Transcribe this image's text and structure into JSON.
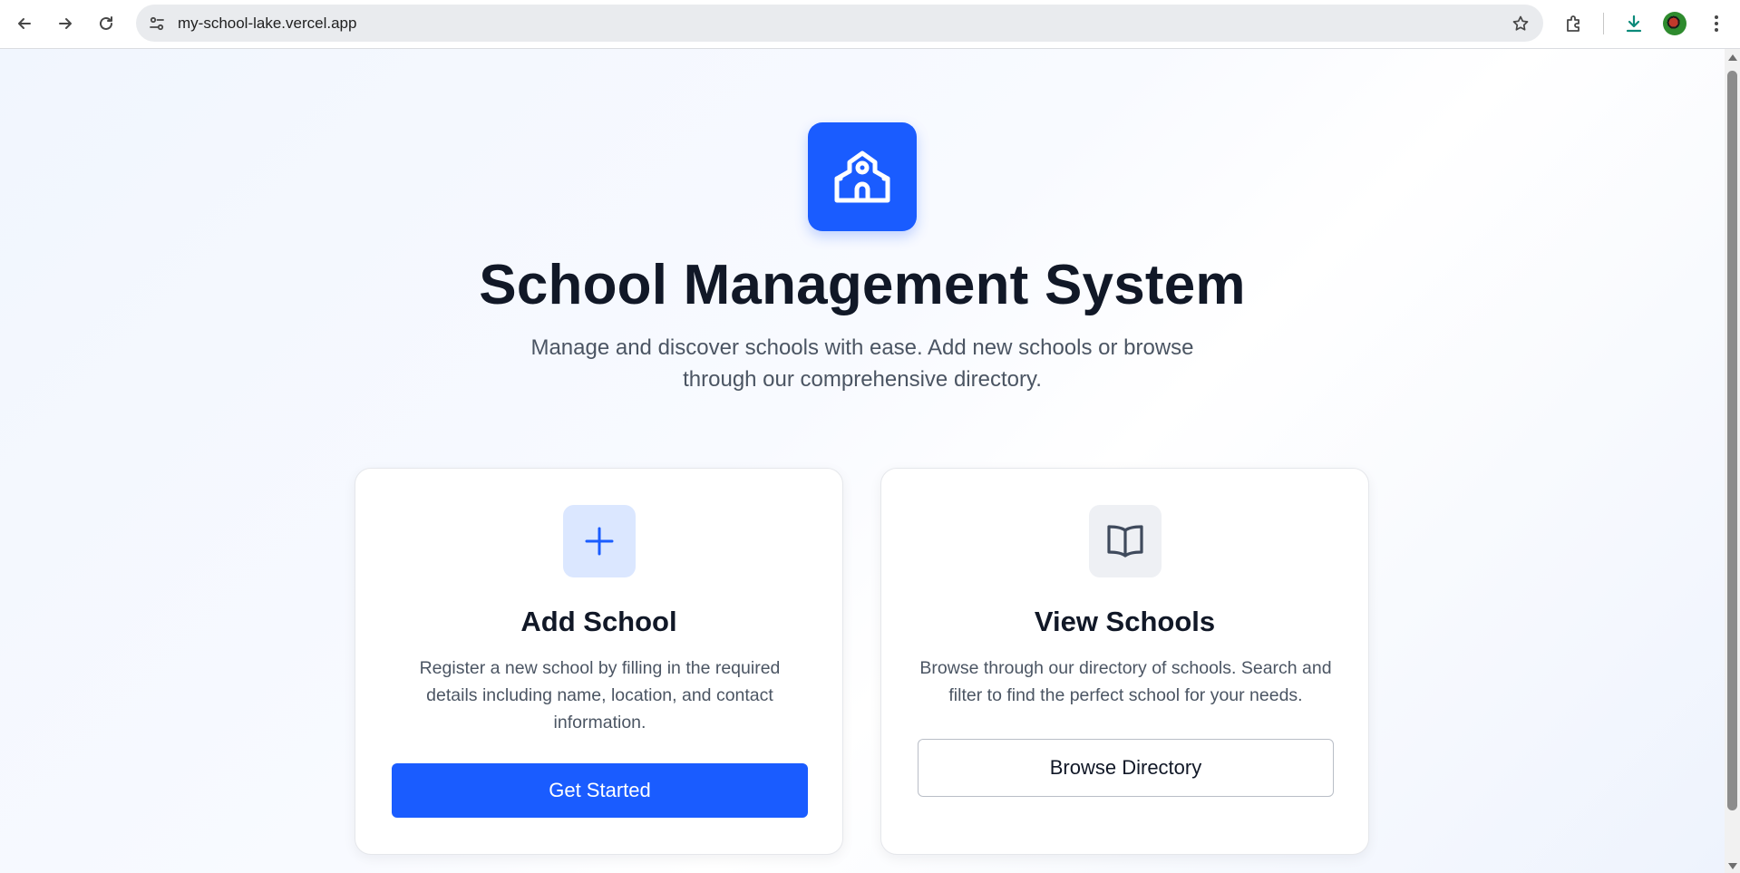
{
  "browser": {
    "url": "my-school-lake.vercel.app",
    "icons": [
      "back-icon",
      "forward-icon",
      "reload-icon",
      "site-info-icon",
      "bookmark-star-icon",
      "extensions-icon",
      "download-icon",
      "profile-avatar",
      "menu-icon"
    ]
  },
  "hero": {
    "logo_icon": "school-building-icon",
    "title": "School Management System",
    "subtitle": "Manage and discover schools with ease. Add new schools or browse through our comprehensive directory."
  },
  "cards": {
    "add": {
      "icon": "plus-icon",
      "title": "Add School",
      "description": "Register a new school by filling in the required details including name, location, and contact information.",
      "button": "Get Started"
    },
    "view": {
      "icon": "open-book-icon",
      "title": "View Schools",
      "description": "Browse through our directory of schools. Search and filter to find the perfect school for your needs.",
      "button": "Browse Directory"
    }
  },
  "colors": {
    "primary": "#1a5cff",
    "title_text": "#111827",
    "body_text": "#4b5563",
    "add_icon_bg": "#dbe7ff",
    "view_icon_bg": "#eef0f4"
  }
}
